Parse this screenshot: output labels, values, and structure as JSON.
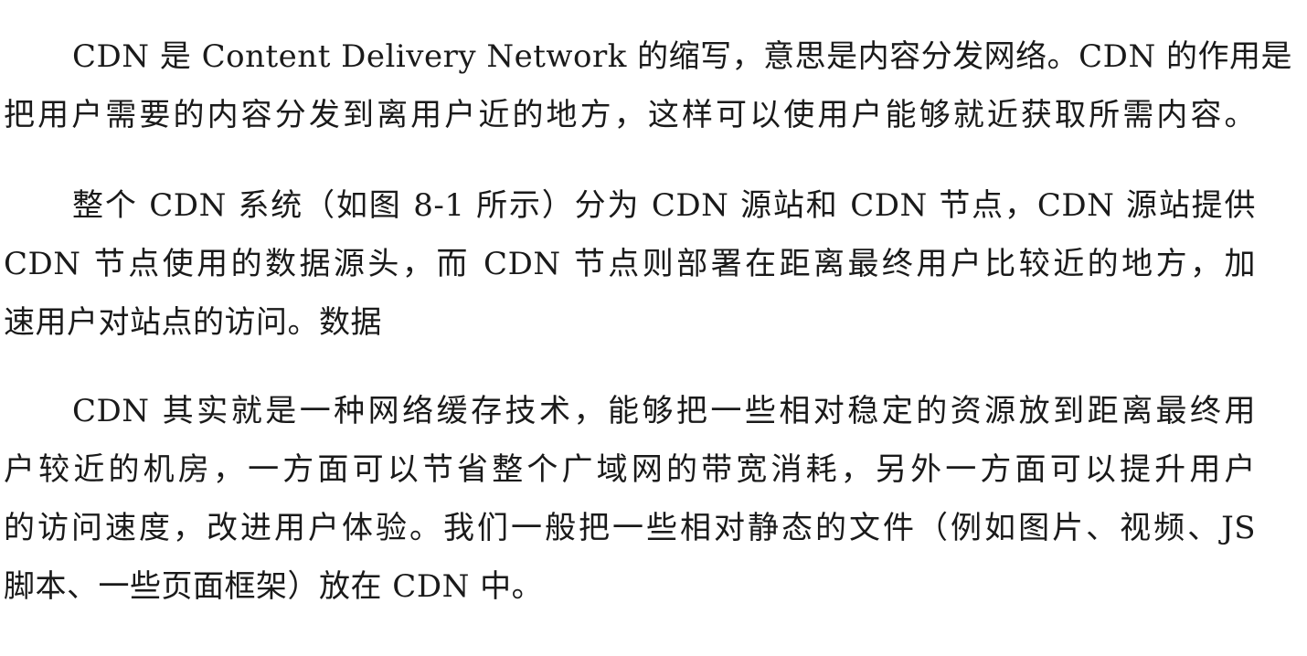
{
  "paragraphs": [
    {
      "lines": [
        "CDN 是 Content Delivery Network 的缩写，意思是内容分发网络。CDN 的作用是",
        "把用户需要的内容分发到离用户近的地方，这样可以使用户能够就近获取所需内容。"
      ]
    },
    {
      "lines": [
        "整个 CDN 系统（如图 8-1 所示）分为 CDN 源站和 CDN 节点，CDN 源站提供",
        "CDN 节点使用的数据源头，而 CDN 节点则部署在距离最终用户比较近的地方，加",
        "速用户对站点的访问。数据"
      ]
    },
    {
      "lines": [
        "CDN 其实就是一种网络缓存技术，能够把一些相对稳定的资源放到距离最终用",
        "户较近的机房，一方面可以节省整个广域网的带宽消耗，另外一方面可以提升用户",
        "的访问速度，改进用户体验。我们一般把一些相对静态的文件（例如图片、视频、JS",
        "脚本、一些页面框架）放在 CDN 中。"
      ]
    }
  ]
}
